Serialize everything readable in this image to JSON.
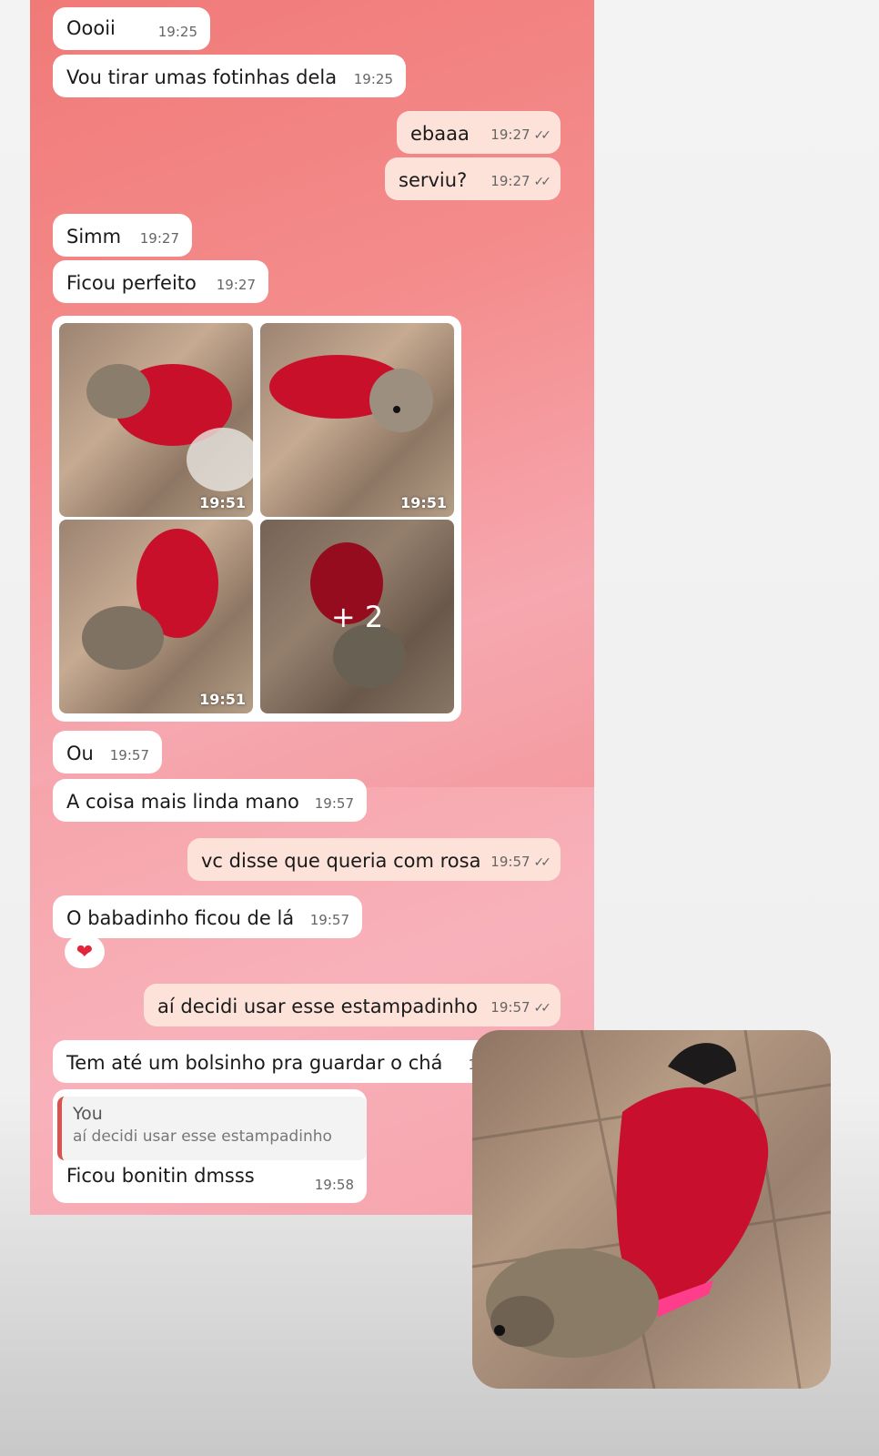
{
  "messages": [
    {
      "text": "Oooii",
      "time": "19:25"
    },
    {
      "text": "Vou tirar umas fotinhas dela",
      "time": "19:25"
    },
    {
      "text": "ebaaa",
      "time": "19:27"
    },
    {
      "text": "serviu?",
      "time": "19:27"
    },
    {
      "text": "Simm",
      "time": "19:27"
    },
    {
      "text": "Ficou perfeito",
      "time": "19:27"
    },
    {
      "text": "Ou",
      "time": "19:57"
    },
    {
      "text": "A coisa mais linda mano",
      "time": "19:57"
    },
    {
      "text": "vc disse que queria com rosa",
      "time": "19:57"
    },
    {
      "text": "O babadinho ficou de lá",
      "time": "19:57"
    },
    {
      "text": "aí decidi usar esse estampadinho",
      "time": "19:57"
    },
    {
      "text": "Tem até um bolsinho pra guardar o chá",
      "time": "1"
    },
    {
      "text": "Ficou bonitin dmsss",
      "time": "19:58"
    }
  ],
  "photo_grid": {
    "times": [
      "19:51",
      "19:51",
      "19:51"
    ],
    "more_count": "+ 2"
  },
  "reaction": {
    "emoji": "❤"
  },
  "quote": {
    "author": "You",
    "text": "aí decidi usar esse estampadinho"
  },
  "colors": {
    "incoming": "#ffffff",
    "outgoing": "#fde2da",
    "panel": "#f48c8c",
    "quote_bar": "#d9534f"
  },
  "icons": {
    "read_ticks": "double-check-icon"
  }
}
